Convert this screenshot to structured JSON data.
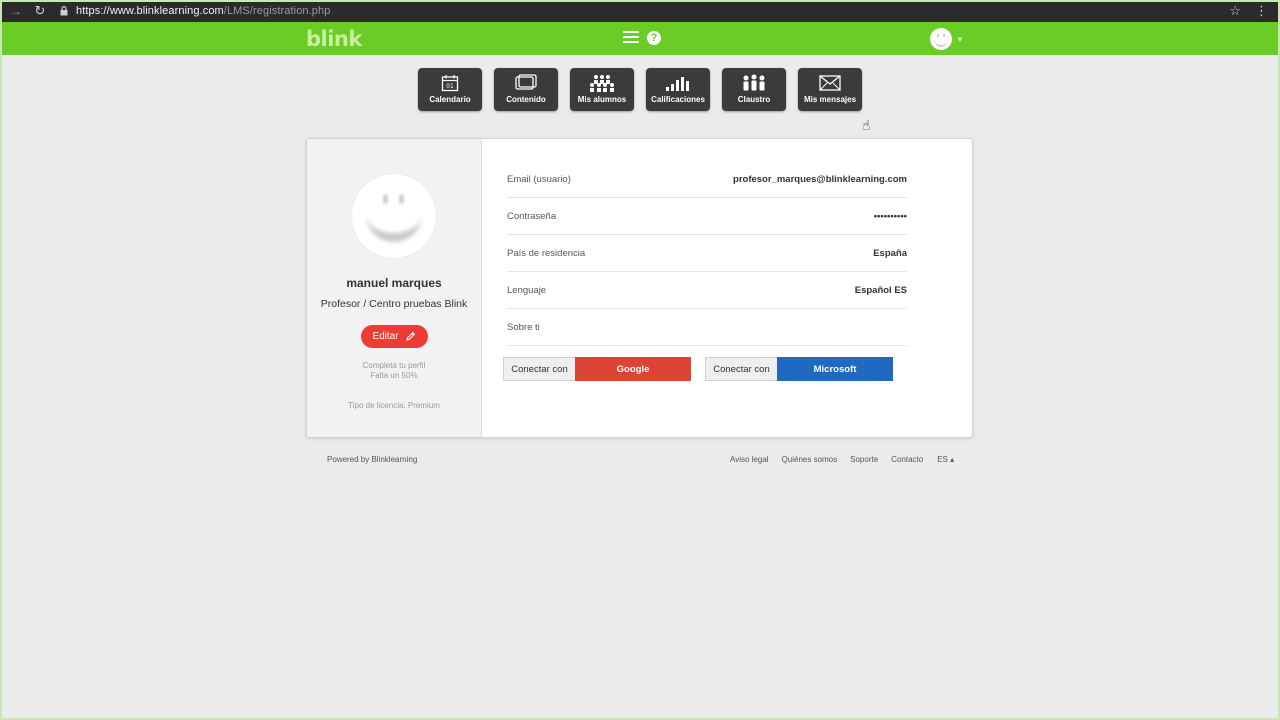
{
  "browser": {
    "url_host": "https://www.blinklearning.com",
    "url_path": "/LMS/registration.php"
  },
  "header": {
    "logo": "blink",
    "help": "?"
  },
  "toolbar": [
    {
      "label": "Calendario",
      "icon": "calendar-icon"
    },
    {
      "label": "Contenido",
      "icon": "content-icon"
    },
    {
      "label": "Mis alumnos",
      "icon": "students-icon"
    },
    {
      "label": "Calificaciones",
      "icon": "grades-icon"
    },
    {
      "label": "Claustro",
      "icon": "staff-icon"
    },
    {
      "label": "Mis mensajes",
      "icon": "envelope-icon"
    }
  ],
  "calendar_day": "01",
  "profile": {
    "name": "manuel marques",
    "role": "Profesor / Centro pruebas Blink",
    "edit_label": "Editar",
    "progress_line1": "Completa tu perfil",
    "progress_line2": "Falta un 50%",
    "license": "Tipo de licencia: Premium"
  },
  "fields": [
    {
      "label": "Email (usuario)",
      "value": "profesor_marques@blinklearning.com"
    },
    {
      "label": "Contraseña",
      "value": "••••••••••"
    },
    {
      "label": "País de residencia",
      "value": "España"
    },
    {
      "label": "Lenguaje",
      "value": "Español ES"
    },
    {
      "label": "Sobre ti",
      "value": ""
    }
  ],
  "connect": {
    "prefix": "Conectar con",
    "google": "Google",
    "microsoft": "Microsoft",
    "google_color": "#dc4533",
    "microsoft_color": "#1f69c0"
  },
  "footer": {
    "powered": "Powered by Blinklearning",
    "links": [
      "Aviso legal",
      "Quiénes somos",
      "Soporte",
      "Contacto"
    ],
    "lang": "ES ▴"
  },
  "colors": {
    "brand_green": "#6bcc25",
    "edit_red": "#ef3b36",
    "tile_dark": "#3b3b3b"
  }
}
